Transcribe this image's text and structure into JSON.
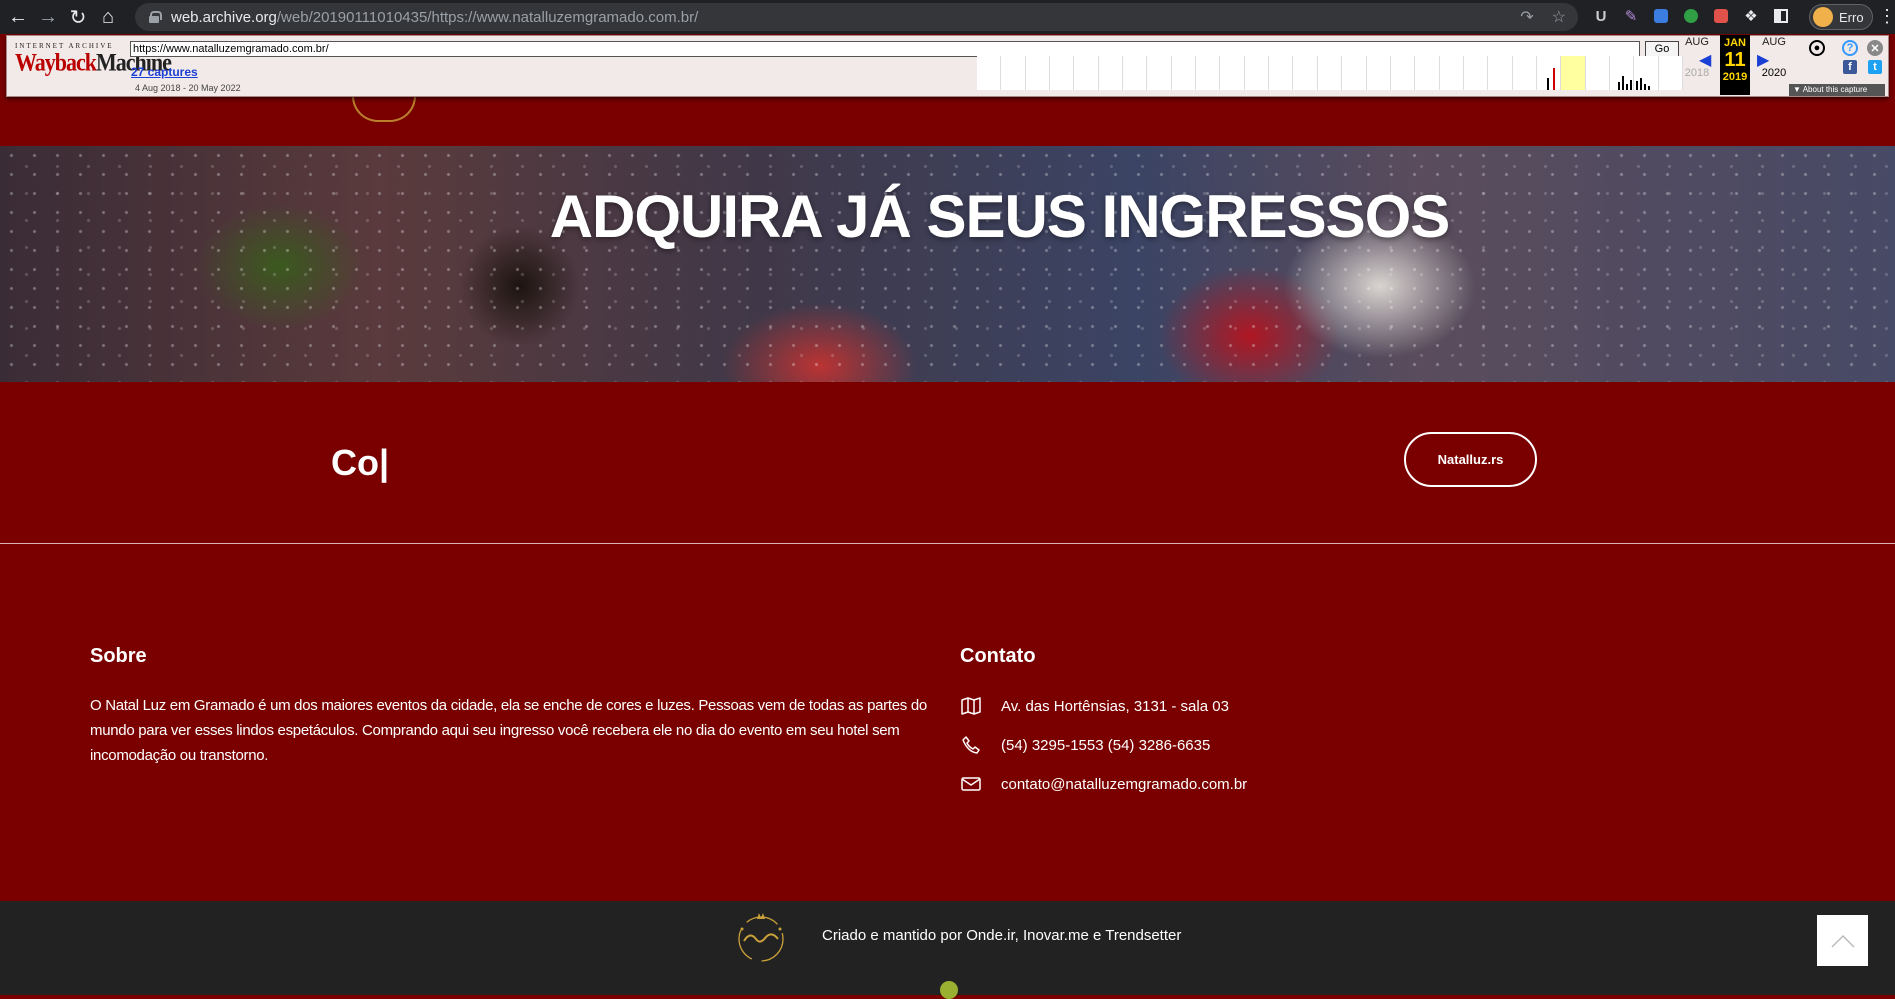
{
  "browser": {
    "url_host": "web.archive.org",
    "url_path": "/web/20190111010435/https://www.natalluzemgramado.com.br/",
    "profile_label": "Erro"
  },
  "wayback": {
    "logo_top": "INTERNET ARCHIVE",
    "logo_way": "Wayback",
    "logo_machine": "Machine",
    "url_value": "https://www.natalluzemgramado.com.br/",
    "go_label": "Go",
    "captures": "27 captures",
    "range": "4 Aug 2018 - 20 May 2022",
    "prev_month": "AUG",
    "prev_year": "2018",
    "cur_month": "JAN",
    "cur_day": "11",
    "cur_year": "2019",
    "next_month": "AUG",
    "next_year": "2020",
    "about": "About this capture"
  },
  "hero": {
    "title": "ADQUIRA JÁ SEUS INGRESSOS"
  },
  "cta": {
    "text": "Co|",
    "button": "Natalluz.rs"
  },
  "about": {
    "title": "Sobre",
    "text": "O Natal Luz em Gramado é um dos maiores eventos da cidade, ela se enche de cores e luzes. Pessoas vem de todas as partes do mundo para ver esses lindos espetáculos. Comprando aqui seu ingresso você recebera ele no dia do evento em seu hotel sem incomodação ou transtorno."
  },
  "contact": {
    "title": "Contato",
    "address": "Av. das Hortênsias, 3131 - sala 03",
    "phone": "(54) 3295-1553 (54) 3286-6635",
    "email": "contato@natalluzemgramado.com.br"
  },
  "footer": {
    "credits": "Criado e mantido por Onde.ir, Inovar.me e Trendsetter"
  },
  "colors": {
    "brand_red": "#7a0000",
    "footer_dark": "#222222",
    "gold": "#caa13a"
  }
}
